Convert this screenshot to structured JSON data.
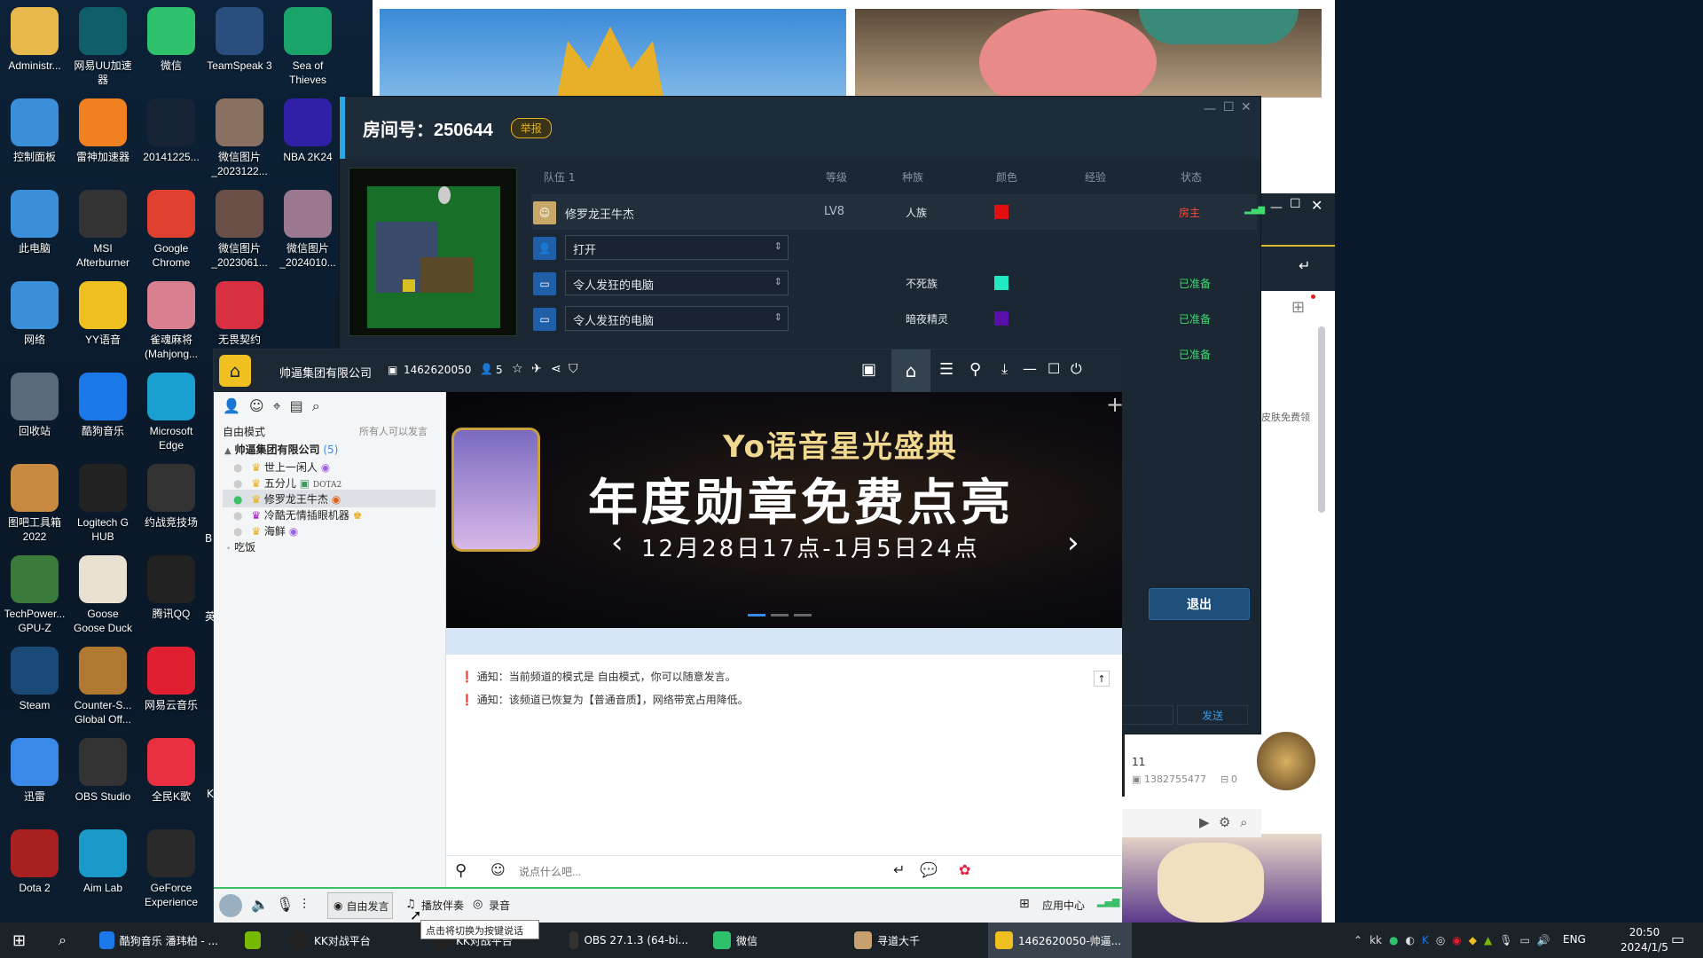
{
  "desktop": {
    "icons": [
      {
        "label": "Administr...",
        "icon": "user-folder-icon",
        "color": "#e8b84a",
        "col": 0,
        "row": 0
      },
      {
        "label": "网易UU加速器",
        "icon": "uu-accelerator-icon",
        "color": "#0f5e6a",
        "col": 1,
        "row": 0
      },
      {
        "label": "微信",
        "icon": "wechat-icon",
        "color": "#2dc26b",
        "col": 2,
        "row": 0
      },
      {
        "label": "TeamSpeak 3",
        "icon": "teamspeak-icon",
        "color": "#2a4f7e",
        "col": 3,
        "row": 0
      },
      {
        "label": "Sea of Thieves",
        "icon": "sea-of-thieves-icon",
        "color": "#1aa46a",
        "col": 4,
        "row": 0
      },
      {
        "label": "控制面板",
        "icon": "control-panel-icon",
        "color": "#3a8fd8",
        "col": 0,
        "row": 1
      },
      {
        "label": "雷神加速器",
        "icon": "leishen-icon",
        "color": "#f08020",
        "col": 1,
        "row": 1
      },
      {
        "label": "20141225...",
        "icon": "image-file-icon",
        "color": "#162436",
        "col": 2,
        "row": 1
      },
      {
        "label": "微信图片_2023122...",
        "icon": "image-file-icon",
        "color": "#8a7060",
        "col": 3,
        "row": 1
      },
      {
        "label": "NBA 2K24",
        "icon": "nba2k24-icon",
        "color": "#3020a8",
        "col": 4,
        "row": 1
      },
      {
        "label": "此电脑",
        "icon": "this-pc-icon",
        "color": "#3a8fd8",
        "col": 0,
        "row": 2
      },
      {
        "label": "MSI Afterburner",
        "icon": "msi-afterburner-icon",
        "color": "#333",
        "col": 1,
        "row": 2
      },
      {
        "label": "Google Chrome",
        "icon": "chrome-icon",
        "color": "#e04030",
        "col": 2,
        "row": 2
      },
      {
        "label": "微信图片_2023061...",
        "icon": "image-file-icon",
        "color": "#6a5048",
        "col": 3,
        "row": 2
      },
      {
        "label": "微信图片_2024010...",
        "icon": "image-file-icon",
        "color": "#9a7890",
        "col": 4,
        "row": 2
      },
      {
        "label": "网络",
        "icon": "network-icon",
        "color": "#3a8fd8",
        "col": 0,
        "row": 3
      },
      {
        "label": "YY语音",
        "icon": "yy-icon",
        "color": "#f0c020",
        "col": 1,
        "row": 3
      },
      {
        "label": "雀魂麻将(Mahjong...",
        "icon": "mahjong-soul-icon",
        "color": "#d88090",
        "col": 2,
        "row": 3
      },
      {
        "label": "无畏契约",
        "icon": "valorant-icon",
        "color": "#d83040",
        "col": 3,
        "row": 3
      },
      {
        "label": "回收站",
        "icon": "recycle-bin-icon",
        "color": "#5a6a7a",
        "col": 0,
        "row": 4
      },
      {
        "label": "酷狗音乐",
        "icon": "kugou-icon",
        "color": "#1a78e8",
        "col": 1,
        "row": 4
      },
      {
        "label": "Microsoft Edge",
        "icon": "edge-icon",
        "color": "#1aa0d0",
        "col": 2,
        "row": 4
      },
      {
        "label": "图吧工具箱2022",
        "icon": "toolbox-icon",
        "color": "#c88a40",
        "col": 0,
        "row": 5
      },
      {
        "label": "Logitech G HUB",
        "icon": "logitech-icon",
        "color": "#222",
        "col": 1,
        "row": 5
      },
      {
        "label": "约战竞技场",
        "icon": "yuezhan-icon",
        "color": "#333",
        "col": 2,
        "row": 5
      },
      {
        "label": "TechPower... GPU-Z",
        "icon": "gpuz-icon",
        "color": "#3a7a3a",
        "col": 0,
        "row": 6
      },
      {
        "label": "Goose Goose Duck",
        "icon": "goose-icon",
        "color": "#e8e0d0",
        "col": 1,
        "row": 6
      },
      {
        "label": "腾讯QQ",
        "icon": "qq-icon",
        "color": "#222",
        "col": 2,
        "row": 6
      },
      {
        "label": "Steam",
        "icon": "steam-icon",
        "color": "#1a4a78",
        "col": 0,
        "row": 7
      },
      {
        "label": "Counter-S... Global Off...",
        "icon": "csgo-icon",
        "color": "#b07830",
        "col": 1,
        "row": 7
      },
      {
        "label": "网易云音乐",
        "icon": "netease-music-icon",
        "color": "#e02030",
        "col": 2,
        "row": 7
      },
      {
        "label": "迅雷",
        "icon": "xunlei-icon",
        "color": "#3a88e8",
        "col": 0,
        "row": 8
      },
      {
        "label": "OBS Studio",
        "icon": "obs-icon",
        "color": "#333",
        "col": 1,
        "row": 8
      },
      {
        "label": "全民K歌",
        "icon": "kge-icon",
        "color": "#e83040",
        "col": 2,
        "row": 8
      },
      {
        "label": "Dota 2",
        "icon": "dota2-icon",
        "color": "#a82020",
        "col": 0,
        "row": 9
      },
      {
        "label": "Aim Lab",
        "icon": "aimlab-icon",
        "color": "#1a9ac8",
        "col": 1,
        "row": 9
      },
      {
        "label": "GeForce Experience",
        "icon": "geforce-icon",
        "color": "#2a2a2a",
        "col": 2,
        "row": 9
      }
    ],
    "partial_labels": [
      "英",
      "B",
      "K"
    ]
  },
  "room": {
    "title": "房间号：250644",
    "report": "举报",
    "columns": {
      "team": "队伍 1",
      "level": "等级",
      "race": "种族",
      "color": "颜色",
      "exp": "经验",
      "status": "状态"
    },
    "players": [
      {
        "name": "修罗龙王牛杰",
        "level": "LV8",
        "race": "人族",
        "color": "#e01010",
        "status": "房主",
        "status_color": "#ff4a3a"
      },
      {
        "name": "打开",
        "level": "",
        "race": "",
        "color": "",
        "status": "",
        "status_color": ""
      },
      {
        "name": "令人发狂的电脑",
        "level": "",
        "race": "不死族",
        "color": "#20e8c0",
        "status": "已准备",
        "status_color": "#3edb6a"
      },
      {
        "name": "令人发狂的电脑",
        "level": "",
        "race": "暗夜精灵",
        "color": "#5a10a8",
        "status": "已准备",
        "status_color": "#3edb6a"
      },
      {
        "name": "",
        "level": "",
        "race": "",
        "color": "",
        "status": "已准备",
        "status_color": "#3edb6a"
      }
    ],
    "exit_button": "退出",
    "send_button": "发送",
    "side_text": "皮肤免费领"
  },
  "profile_card": {
    "line1": "11",
    "id": "1382755477",
    "count": "0"
  },
  "yy": {
    "channel_name": "帅逼集团有限公司",
    "channel_id": "1462620050",
    "online_count": "5",
    "mode_label": "自由模式",
    "mode_hint": "所有人可以发言",
    "tree": {
      "root": "帅逼集团有限公司",
      "root_count": "(5)",
      "members": [
        {
          "name": "世上一闲人",
          "tag": ""
        },
        {
          "name": "五分儿",
          "tag": "DOTA2"
        },
        {
          "name": "修罗龙王牛杰",
          "tag": ""
        },
        {
          "name": "冷酷无情插眼机器",
          "tag": ""
        },
        {
          "name": "海鲜",
          "tag": ""
        }
      ],
      "subchannel": "吃饭"
    },
    "banner": {
      "line1": "Yo语音星光盛典",
      "line2": "年度勋章免费点亮",
      "line3": "12月28日17点-1月5日24点"
    },
    "notices": [
      "通知：当前频道的模式是 自由模式，你可以随意发言。",
      "通知：该频道已恢复为【普通音质】，网络带宽占用降低。"
    ],
    "input_placeholder": "说点什么吧...",
    "bottom": {
      "free_speak": "自由发言",
      "tooltip": "点击将切换为按键说话",
      "accompany": "播放伴奏",
      "record": "录音",
      "app_center": "应用中心"
    }
  },
  "taskbar": {
    "items": [
      {
        "label": "酷狗音乐 潘玮柏 - ...",
        "icon": "kugou-icon",
        "color": "#1a78e8"
      },
      {
        "label": "",
        "icon": "nvidia-icon",
        "color": "#76b900"
      },
      {
        "label": "KK对战平台",
        "icon": "kk-icon",
        "color": "#222"
      },
      {
        "label": "KK对战平台",
        "icon": "kk-icon",
        "color": "#222"
      },
      {
        "label": "OBS 27.1.3 (64-bi...",
        "icon": "obs-icon",
        "color": "#333"
      },
      {
        "label": "微信",
        "icon": "wechat-icon",
        "color": "#2dc26b"
      },
      {
        "label": "寻道大千",
        "icon": "game-icon",
        "color": "#c8a070"
      },
      {
        "label": "1462620050-帅逼...",
        "icon": "yy-icon",
        "color": "#f0c020"
      }
    ],
    "lang": "ENG",
    "time": "20:50",
    "date": "2024/1/5"
  }
}
